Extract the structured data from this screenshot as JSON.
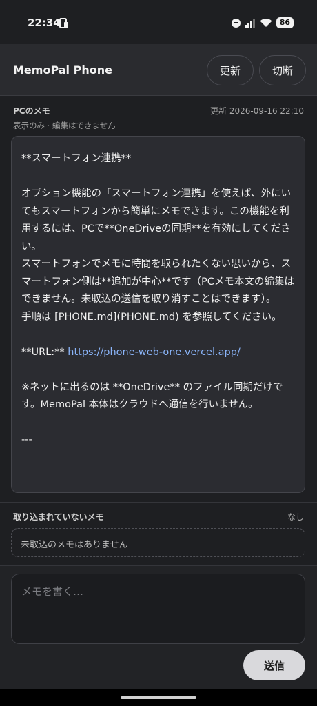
{
  "status_bar": {
    "time": "22:34",
    "battery": "86",
    "icons": [
      "phone-link-icon",
      "do-not-disturb-icon",
      "signal-icon",
      "wifi-icon",
      "battery-icon"
    ]
  },
  "header": {
    "title": "MemoPal Phone",
    "refresh_label": "更新",
    "disconnect_label": "切断"
  },
  "pc_memo": {
    "label": "PCのメモ",
    "updated": "更新 2026-09-16 22:10",
    "subtitle": "表示のみ · 編集はできません",
    "body_before_link": "**スマートフォン連携**\n\nオプション機能の「スマートフォン連携」を使えば、外にいてもスマートフォンから簡単にメモできます。この機能を利用するには、PCで**OneDriveの同期**を有効にしてください。\nスマートフォンでメモに時間を取られたくない思いから、スマートフォン側は**追加が中心**です（PCメモ本文の編集はできません。未取込の送信を取り消すことはできます）。\n手順は [PHONE.md](PHONE.md) を参照してください。\n\n**URL:** ",
    "link_text": "https://phone-web-one.vercel.app/",
    "body_after_link": "\n\n※ネットに出るのは **OneDrive** のファイル同期だけです。MemoPal 本体はクラウドへ通信を行いません。\n\n---"
  },
  "unimported": {
    "label": "取り込まれていないメモ",
    "count_text": "なし",
    "empty_text": "未取込のメモはありません"
  },
  "composer": {
    "placeholder": "メモを書く…",
    "send_label": "送信"
  },
  "colors": {
    "background": "#1e1f22",
    "card": "#2b2c31",
    "link": "#8ab4f8",
    "send_button": "#d9d9dc"
  }
}
